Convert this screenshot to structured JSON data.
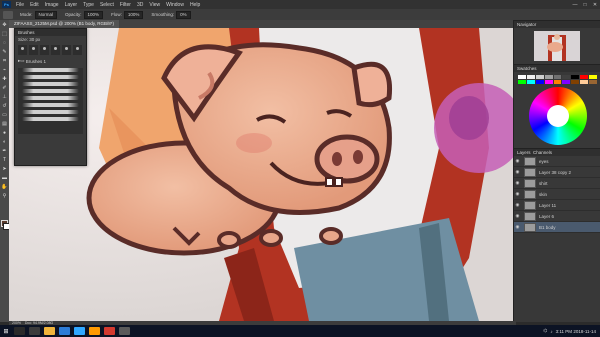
{
  "menubar": {
    "logo": "Ps",
    "items": [
      "File",
      "Edit",
      "Image",
      "Layer",
      "Type",
      "Select",
      "Filter",
      "3D",
      "View",
      "Window",
      "Help"
    ],
    "window_controls": [
      "—",
      "□",
      "✕"
    ]
  },
  "options_bar": {
    "mode_label": "Mode:",
    "mode_value": "Normal",
    "opacity_label": "Opacity:",
    "opacity_value": "100%",
    "flow_label": "Flow:",
    "flow_value": "100%",
    "smoothing_label": "Smoothing:",
    "smoothing_value": "0%"
  },
  "document_tab": "ZIFAASS_2125M.psd @ 200% (B1 body, RGB/8*)",
  "brushes_panel": {
    "title": "Brushes",
    "size_label": "Size:",
    "size_value": "30 px",
    "folder_label": "Brushes 1"
  },
  "right_panel": {
    "navigator_title": "Navigator",
    "swatches_title": "Swatches",
    "layers_title": "Layers",
    "channels_title": "Channels",
    "layers": [
      {
        "name": "eyes",
        "selected": false
      },
      {
        "name": "Layer 38 copy 2",
        "selected": false
      },
      {
        "name": "shirt",
        "selected": false
      },
      {
        "name": "skin",
        "selected": false
      },
      {
        "name": "Layer 11",
        "selected": false
      },
      {
        "name": "Layer 6",
        "selected": false
      },
      {
        "name": "B1 body",
        "selected": true
      }
    ]
  },
  "status": {
    "zoom": "200%",
    "doc": "Doc: 94.9M/2.08G"
  },
  "taskbar": {
    "time": "3:11 PM",
    "date": "2018-11-14"
  },
  "colors": {
    "swatches": [
      "#ffffff",
      "#f0f0f0",
      "#d0d0d0",
      "#a0a0a0",
      "#707070",
      "#404040",
      "#000000",
      "#ff0000",
      "#ffff00",
      "#00ff00",
      "#00ffff",
      "#0000ff",
      "#ff00ff",
      "#ff8000",
      "#8000ff",
      "#804000",
      "#ffcc99",
      "#996633"
    ]
  }
}
